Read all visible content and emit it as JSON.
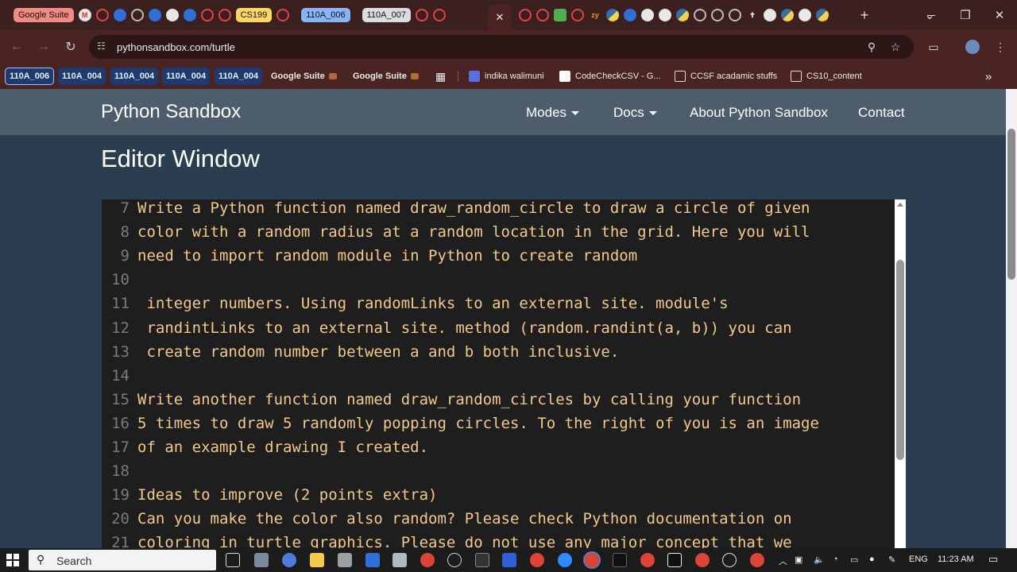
{
  "browser": {
    "tab_groups": [
      "Google Suite",
      "CS199",
      "110A_006",
      "110A_007"
    ],
    "active_tab_close": "✕",
    "new_tab": "+",
    "window_controls": {
      "tab_search": "⌄",
      "minimize": "—",
      "restore": "❐",
      "close": "✕"
    },
    "url": "pythonsandbox.com/turtle",
    "bookmarks": [
      "110A_006",
      "110A_004",
      "110A_004",
      "110A_004",
      "110A_004",
      "Google Suite",
      "Google Suite",
      "indika walimuni",
      "CodeCheckCSV - G...",
      "CCSF acadamic stuffs",
      "CS10_content"
    ],
    "bookmarks_overflow": "»"
  },
  "site": {
    "brand": "Python Sandbox",
    "nav": [
      {
        "label": "Modes",
        "dropdown": true
      },
      {
        "label": "Docs",
        "dropdown": true
      },
      {
        "label": "About Python Sandbox",
        "dropdown": false
      },
      {
        "label": "Contact",
        "dropdown": false
      }
    ],
    "heading": "Editor Window"
  },
  "editor": {
    "lines": [
      {
        "n": "7",
        "text": "Write a Python function named draw_random_circle to draw a circle of given"
      },
      {
        "n": "8",
        "text": "color with a random radius at a random location in the grid. Here you will"
      },
      {
        "n": "9",
        "text": "need to import random module in Python to create random"
      },
      {
        "n": "10",
        "text": ""
      },
      {
        "n": "11",
        "text": " integer numbers. Using randomLinks to an external site. module's"
      },
      {
        "n": "12",
        "text": " randintLinks to an external site. method (random.randint(a, b)) you can"
      },
      {
        "n": "13",
        "text": " create random number between a and b both inclusive."
      },
      {
        "n": "14",
        "text": ""
      },
      {
        "n": "15",
        "text": "Write another function named draw_random_circles by calling your function"
      },
      {
        "n": "16",
        "text": "5 times to draw 5 randomly popping circles. To the right of you is an image"
      },
      {
        "n": "17",
        "text": "of an example drawing I created."
      },
      {
        "n": "18",
        "text": ""
      },
      {
        "n": "19",
        "text": "Ideas to improve (2 points extra)"
      },
      {
        "n": "20",
        "text": "Can you make the color also random? Please check Python documentation on"
      },
      {
        "n": "21",
        "text": "coloring in turtle graphics. Please do not use any major concept that we"
      }
    ]
  },
  "taskbar": {
    "search_placeholder": "Search",
    "language": "ENG",
    "time": "11:23 AM"
  },
  "colors": {
    "page_bg": "#2b3e50",
    "navbar_bg": "#4e5d6c",
    "editor_bg": "#1e1e1e",
    "code_text": "#f5c88a",
    "chrome_bg": "#4a2323"
  }
}
